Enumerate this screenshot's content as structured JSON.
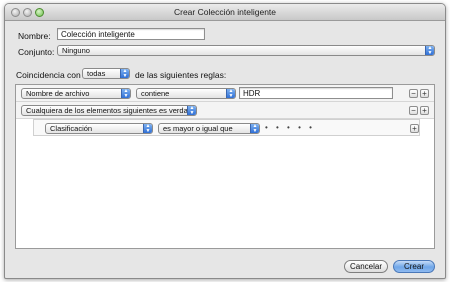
{
  "window": {
    "title": "Crear Colección inteligente"
  },
  "name_field": {
    "label": "Nombre:",
    "value": "Colección inteligente"
  },
  "set_field": {
    "label": "Conjunto:",
    "value": "Ninguno"
  },
  "match": {
    "prefix": "Coincidencia con",
    "value": "todas",
    "suffix": "de las siguientes reglas:"
  },
  "rules": [
    {
      "field": "Nombre de archivo",
      "operator": "contiene",
      "value": "HDR"
    }
  ],
  "group_rule": {
    "field": "Cualquiera de los elementos siguientes es verdadero"
  },
  "sub_rule": {
    "field": "Clasificación",
    "operator": "es mayor o igual que",
    "rating_dots": "• • • • •"
  },
  "controls": {
    "minus": "−",
    "plus": "+"
  },
  "buttons": {
    "cancel": "Cancelar",
    "create": "Crear"
  },
  "icons": {
    "close": "close-icon",
    "minimize": "minimize-icon",
    "zoom": "zoom-icon",
    "popup_arrows": "updown-arrows-icon"
  }
}
